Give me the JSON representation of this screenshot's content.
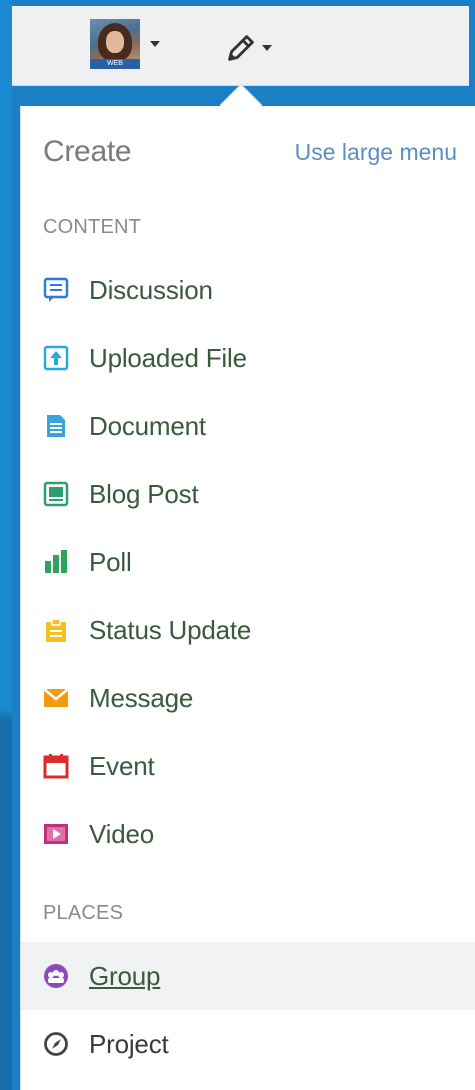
{
  "header": {
    "avatar_badge": "WEB",
    "user_menu_label": "user menu",
    "create_menu_label": "create"
  },
  "menu": {
    "title": "Create",
    "large_menu_link": "Use large menu",
    "sections": {
      "content_label": "CONTENT",
      "places_label": "PLACES"
    },
    "content_items": [
      {
        "label": "Discussion",
        "icon": "discussion-icon",
        "color": "#2e7bd0"
      },
      {
        "label": "Uploaded File",
        "icon": "upload-icon",
        "color": "#27a9e0"
      },
      {
        "label": "Document",
        "icon": "document-icon",
        "color": "#3aa3d8"
      },
      {
        "label": "Blog Post",
        "icon": "blog-icon",
        "color": "#2e9e6e"
      },
      {
        "label": "Poll",
        "icon": "poll-icon",
        "color": "#2ea35a"
      },
      {
        "label": "Status Update",
        "icon": "status-icon",
        "color": "#f4c020"
      },
      {
        "label": "Message",
        "icon": "message-icon",
        "color": "#f39c12"
      },
      {
        "label": "Event",
        "icon": "event-icon",
        "color": "#d62e2e"
      },
      {
        "label": "Video",
        "icon": "video-icon",
        "color": "#c0307a"
      }
    ],
    "place_items": [
      {
        "label": "Group",
        "icon": "group-icon",
        "color": "#8a4bb8"
      },
      {
        "label": "Project",
        "icon": "project-icon",
        "color": "#444444"
      }
    ]
  }
}
